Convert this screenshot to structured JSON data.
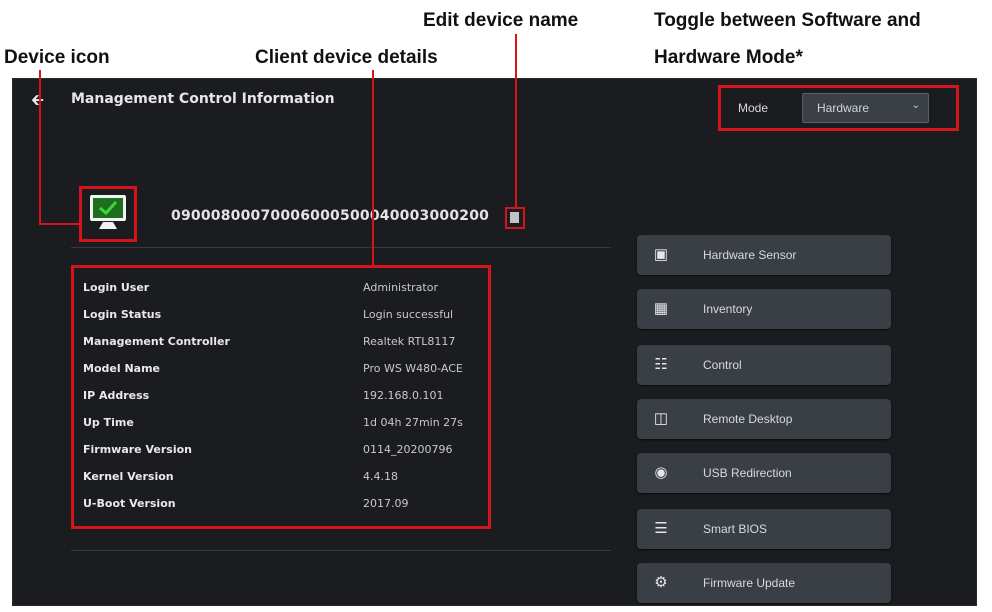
{
  "callouts": {
    "device_icon": "Device icon",
    "client_details": "Client device details",
    "edit_name": "Edit device name",
    "toggle_mode_1": "Toggle between Software and",
    "toggle_mode_2": "Hardware Mode*"
  },
  "header": {
    "back_icon": "back-arrow-icon",
    "title": "Management Control Information"
  },
  "mode": {
    "label": "Mode",
    "selected": "Hardware"
  },
  "device": {
    "icon": "monitor-check-icon",
    "name": "09000800070006000500040003000200",
    "edit_icon": "edit-icon"
  },
  "details": [
    {
      "key": "Login  User",
      "value": "Administrator"
    },
    {
      "key": "Login Status",
      "value": "Login successful"
    },
    {
      "key": "Management Controller",
      "value": "Realtek RTL8117"
    },
    {
      "key": "Model Name",
      "value": "Pro WS W480-ACE"
    },
    {
      "key": "IP Address",
      "value": "192.168.0.101"
    },
    {
      "key": "Up Time",
      "value": "1d 04h 27min 27s"
    },
    {
      "key": "Firmware Version",
      "value": "0114_20200796"
    },
    {
      "key": "Kernel Version",
      "value": "4.4.18"
    },
    {
      "key": "U-Boot Version",
      "value": "2017.09"
    }
  ],
  "nav": [
    {
      "label": "Hardware Sensor",
      "icon": "sensor-icon"
    },
    {
      "label": "Inventory",
      "icon": "inventory-icon"
    },
    {
      "label": "Control",
      "icon": "sliders-icon"
    },
    {
      "label": "Remote Desktop",
      "icon": "remote-desktop-icon"
    },
    {
      "label": "USB Redirection",
      "icon": "usb-icon"
    },
    {
      "label": "Smart BIOS",
      "icon": "list-icon"
    },
    {
      "label": "Firmware Update",
      "icon": "chip-icon"
    }
  ],
  "colors": {
    "annotation": "#d4161c",
    "panel_bg": "#1b1c1f",
    "button_bg": "#3a3e45",
    "icon_green": "#2fb52f"
  }
}
